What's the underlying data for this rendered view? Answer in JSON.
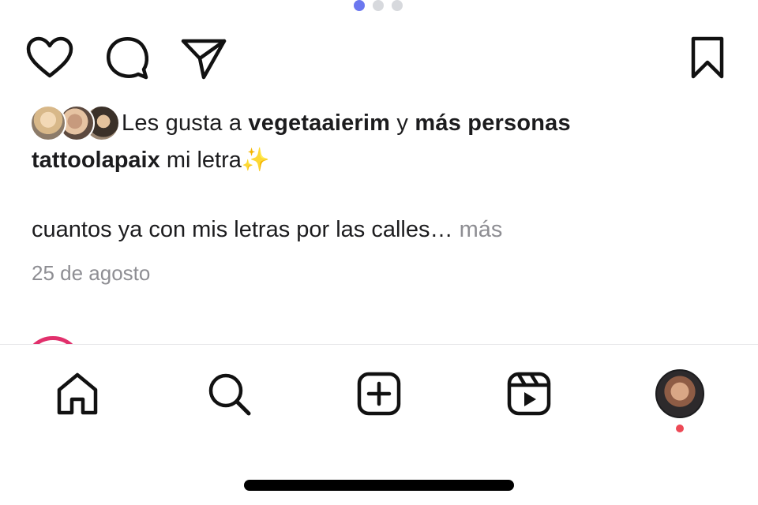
{
  "carousel": {
    "count": 3,
    "active_index": 0
  },
  "actions": {
    "like_icon": "heart-icon",
    "comment_icon": "comment-icon",
    "share_icon": "paper-plane-icon",
    "save_icon": "bookmark-icon"
  },
  "likes": {
    "prefix": "Les gusta a",
    "user": "vegetaaierim",
    "connector": "y",
    "others": "más personas"
  },
  "caption": {
    "username": "tattoolapaix",
    "text": "mi letra",
    "emoji": "✨"
  },
  "comment": {
    "text": "cuantos ya con mis letras por las calles…",
    "more_label": "más"
  },
  "post_date": "25 de agosto",
  "tabbar": {
    "items": [
      "home-icon",
      "search-icon",
      "create-icon",
      "reels-icon",
      "profile-avatar"
    ],
    "notification_dot_color": "#ed4956"
  },
  "colors": {
    "carousel_active": "#6b77ef",
    "carousel_inactive": "#d7d9dd",
    "secondary_text": "#8e8e93",
    "story_ring": "#e1306c"
  }
}
